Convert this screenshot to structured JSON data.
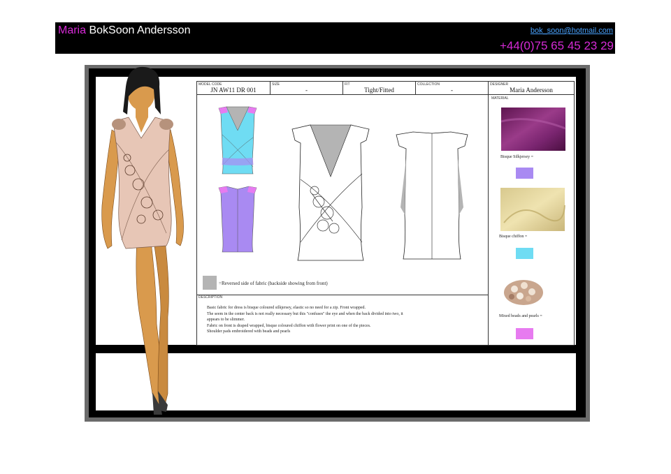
{
  "header": {
    "first_name": "Maria",
    "last_name": "BokSoon Andersson",
    "email": "bok_soon@hotmail.com",
    "phone": "+44(0)75 65 45 23 29"
  },
  "spec_sheet": {
    "fields": [
      {
        "label": "MODEL CODE",
        "value": "JN AW11 DR 001"
      },
      {
        "label": "SIZE",
        "value": "-"
      },
      {
        "label": "FIT",
        "value": "Tight/Fitted"
      },
      {
        "label": "COLLECTION",
        "value": "-"
      },
      {
        "label": "DESIGNER",
        "value": "Maria Andersson"
      }
    ],
    "material_label": "MATERIAL",
    "materials": [
      {
        "name": "Bisque Silkjersey =",
        "chip_color": "#a98af2"
      },
      {
        "name": "Bisque chiffon =",
        "chip_color": "#6fdcf3"
      },
      {
        "name": "Mixed beads and pearls =",
        "chip_color": "#e77bf0"
      }
    ],
    "legend": "=Reversed side of fabric (backside showing from front)",
    "description_label": "DESCRIPTION",
    "description_lines": [
      "Basic fabric for dress is bisque coloured silkjersey, elastic so no need for a zip.  Front wrapped.",
      "The seem in the center back is not really necessary but this \"confuses\" the eye and when the back divided into two, it",
      "appears to be slimmer.",
      "Fabric on front is draped wrapped, bisque coloured chiffon with flower print on one of the pieces.",
      "Shoulder pads embroidered with beads and pearls"
    ]
  },
  "colors": {
    "accent_magenta": "#d62ad6",
    "link_blue": "#4aa3ff",
    "reverse_grey": "#b4b4b4",
    "cyan_fabric": "#6fdcf3",
    "lilac_fabric": "#a98af2",
    "pink_fabric": "#e77bf0"
  }
}
